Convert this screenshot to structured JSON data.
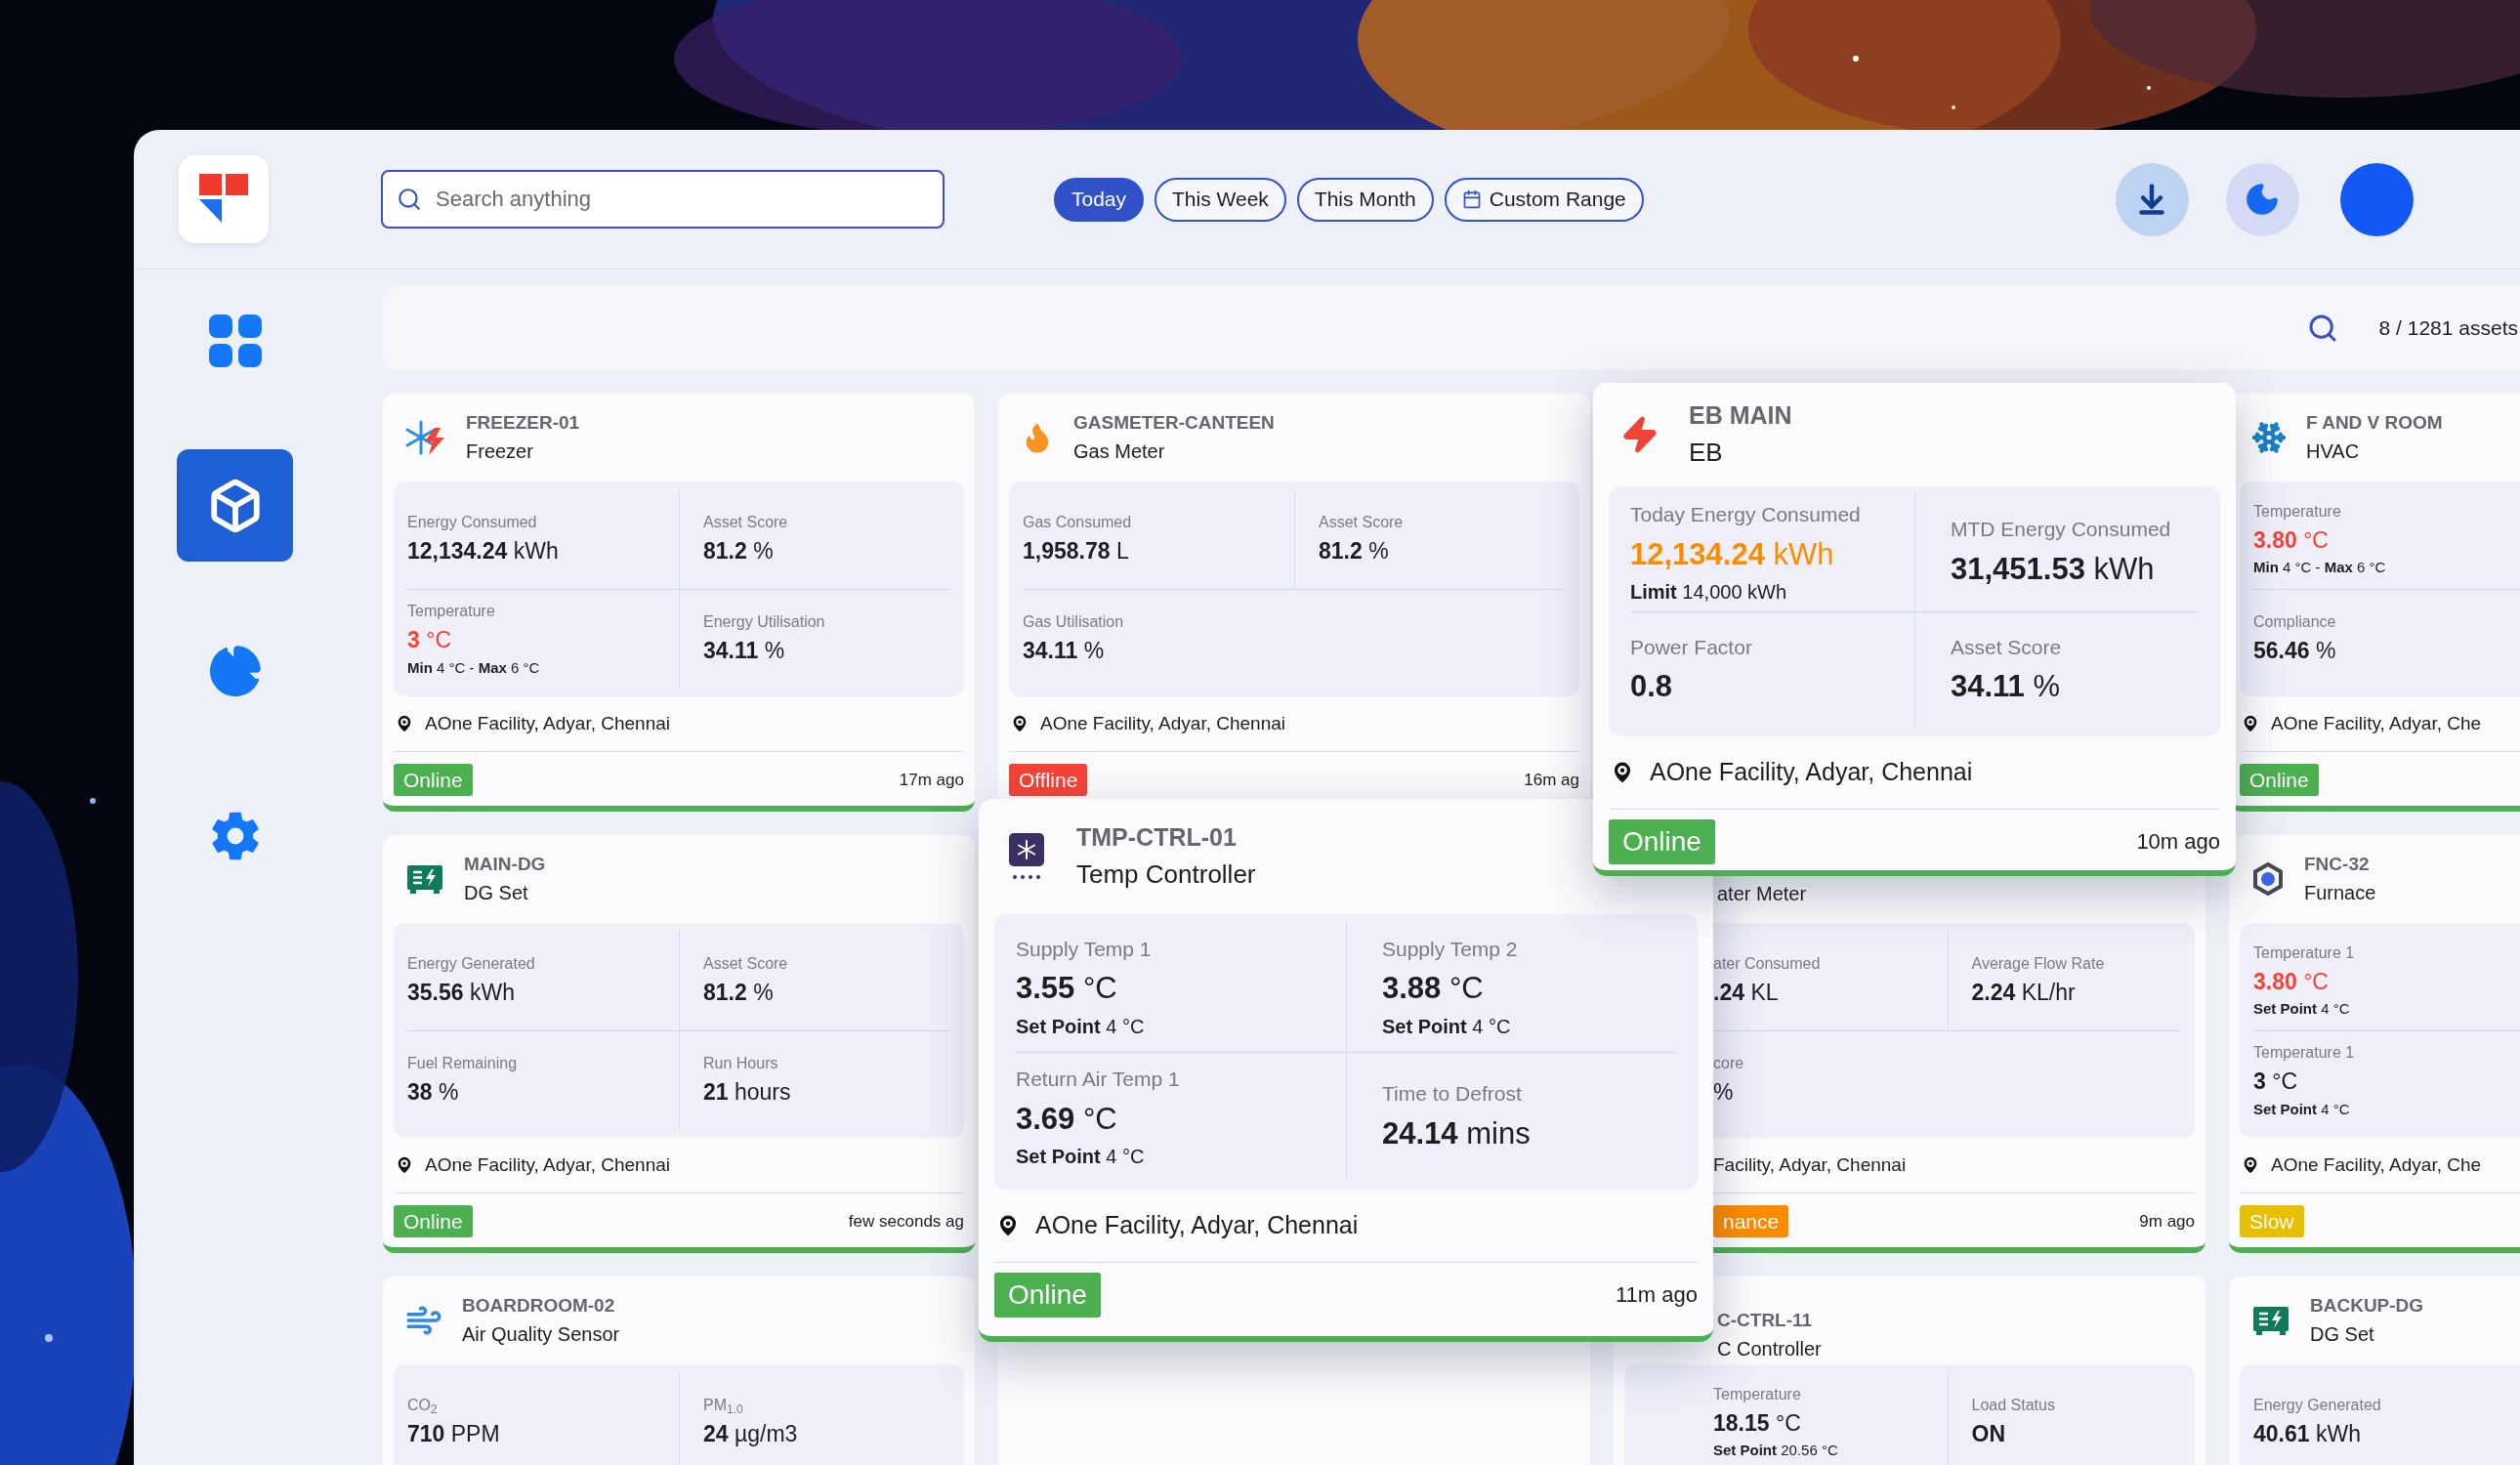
{
  "search": {
    "placeholder": "Search anything"
  },
  "date_filters": [
    {
      "label": "Today",
      "selected": true,
      "kind": "preset"
    },
    {
      "label": "This Week",
      "selected": false,
      "kind": "preset"
    },
    {
      "label": "This Month",
      "selected": false,
      "kind": "preset"
    },
    {
      "label": "Custom Range",
      "selected": false,
      "kind": "range"
    }
  ],
  "sidebar": {
    "items": [
      {
        "kind": "dashboard",
        "selected": false
      },
      {
        "kind": "assets",
        "selected": true
      },
      {
        "kind": "reports",
        "selected": false
      },
      {
        "kind": "settings",
        "selected": false
      }
    ]
  },
  "asset_count": "8 / 1281 assets",
  "cards": [
    {
      "name": "FREEZER-01",
      "type": "Freezer",
      "kind": "freezer",
      "popup": false,
      "rows": [
        [
          {
            "label": "Energy Consumed",
            "value": "12,134.24",
            "unit": "kWh"
          },
          {
            "label": "Asset Score",
            "value": "81.2",
            "unit": "%"
          }
        ],
        [
          {
            "label": "Temperature",
            "value": "3",
            "unit": "°C",
            "color": "#f44336",
            "note": "**Min** 4 °C - **Max** 6 °C"
          },
          {
            "label": "Energy Utilisation",
            "value": "34.11",
            "unit": "%"
          }
        ]
      ],
      "location": "AOne Facility, Adyar, Chennai",
      "status": {
        "label": "Online",
        "kind": "online"
      },
      "time": "17m ago"
    },
    {
      "name": "GASMETER-CANTEEN",
      "type": "Gas Meter",
      "kind": "gas",
      "popup": false,
      "rows": [
        [
          {
            "label": "Gas Consumed",
            "value": "1,958.78",
            "unit": "L"
          },
          {
            "label": "Asset Score",
            "value": "81.2",
            "unit": "%"
          }
        ],
        [
          {
            "label": "Gas Utilisation",
            "value": "34.11",
            "unit": "%"
          }
        ]
      ],
      "location": "AOne Facility, Adyar, Chennai",
      "status": {
        "label": "Offline",
        "kind": "offline"
      },
      "time": "16m ag"
    },
    {
      "name": "EB MAIN",
      "type": "EB",
      "kind": "eb",
      "popup": true,
      "rows": [
        [
          {
            "label": "Today Energy Consumed",
            "value": "12,134.24",
            "unit": "kWh",
            "color": "#fb8c00",
            "note": "**Limit** 14,000 kWh"
          },
          {
            "label": "MTD Energy Consumed",
            "value": "31,451.53",
            "unit": "kWh"
          }
        ],
        [
          {
            "label": "Power Factor",
            "value": "0.8"
          },
          {
            "label": "Asset Score",
            "value": "34.11",
            "unit": "%"
          }
        ]
      ],
      "location": "AOne Facility, Adyar, Chennai",
      "status": {
        "label": "Online",
        "kind": "online"
      },
      "time": "10m ago"
    },
    {
      "name": "F AND V ROOM",
      "type": "HVAC",
      "kind": "hvac",
      "popup": false,
      "rows": [
        [
          {
            "label": "Temperature",
            "value": "3.80",
            "unit": "°C",
            "color": "#f44336",
            "note": "**Min** 4 °C - **Max** 6 °C"
          }
        ],
        [
          {
            "label": "Compliance",
            "value": "56.46",
            "unit": "%"
          }
        ]
      ],
      "location": "AOne Facility, Adyar, Che",
      "status": {
        "label": "Online",
        "kind": "online"
      }
    },
    {
      "name": "MAIN-DG",
      "type": "DG Set",
      "kind": "dg",
      "popup": false,
      "rows": [
        [
          {
            "label": "Energy Generated",
            "value": "35.56",
            "unit": "kWh"
          },
          {
            "label": "Asset Score",
            "value": "81.2",
            "unit": "%"
          }
        ],
        [
          {
            "label": "Fuel Remaining",
            "value": "38",
            "unit": "%"
          },
          {
            "label": "Run Hours",
            "value": "21",
            "unit": "hours"
          }
        ]
      ],
      "location": "AOne Facility, Adyar, Chennai",
      "status": {
        "label": "Online",
        "kind": "online"
      },
      "time": "few seconds ag"
    },
    {
      "name": "TMP-CTRL-01",
      "type": "Temp Controller",
      "kind": "temp",
      "popup": true,
      "rows": [
        [
          {
            "label": "Supply Temp 1",
            "value": "3.55",
            "unit": "°C",
            "note": "**Set Point** 4 °C"
          },
          {
            "label": "Supply Temp 2",
            "value": "3.88",
            "unit": "°C",
            "note": "**Set Point** 4 °C"
          }
        ],
        [
          {
            "label": "Return Air Temp 1",
            "value": "3.69",
            "unit": "°C",
            "note": "**Set Point** 4 °C"
          },
          {
            "label": "Time to Defrost",
            "value": "24.14",
            "unit": "mins"
          }
        ]
      ],
      "location": "AOne Facility, Adyar, Chennai",
      "status": {
        "label": "Online",
        "kind": "online"
      },
      "time": "11m ago"
    },
    {
      "kind": "partial",
      "popup": false,
      "type": "ater Meter",
      "rows": [
        [
          {
            "label": "ater Consumed",
            "value": ".24",
            "unit": "KL"
          },
          {
            "label": "Average Flow Rate",
            "value": "2.24",
            "unit": "KL/hr"
          }
        ],
        [
          {
            "label": "core",
            "unit": "%"
          }
        ]
      ],
      "location": "Facility, Adyar, Chennai",
      "status": {
        "label": "nance",
        "kind": "maintenance"
      },
      "time": "9m ago"
    },
    {
      "name": "FNC-32",
      "type": "Furnace",
      "kind": "furnace",
      "popup": false,
      "rows": [
        [
          {
            "label": "Temperature 1",
            "value": "3.80",
            "unit": "°C",
            "color": "#f44336",
            "note": "**Set Point** 4 °C"
          }
        ],
        [
          {
            "label": "Temperature 1",
            "value": "3",
            "unit": "°C",
            "note": "**Set Point** 4 °C"
          }
        ]
      ],
      "location": "AOne Facility, Adyar, Che",
      "status": {
        "label": "Slow",
        "kind": "slow"
      }
    },
    {
      "name": "BOARDROOM-02",
      "type": "Air Quality Sensor",
      "kind": "air",
      "popup": false,
      "rows": [
        [
          {
            "label": "CO$_{2}$",
            "value": "710",
            "unit": "PPM"
          },
          {
            "label": "PM$_{1.0}$",
            "value": "24",
            "unit": "µg/m3"
          }
        ]
      ]
    },
    {
      "kind": "blank",
      "popup": false
    },
    {
      "kind": "partial",
      "popup": false,
      "name": "C-CTRL-11",
      "type": "C Controller",
      "rows": [
        [
          {
            "label": "Temperature",
            "value": "18.15",
            "unit": "°C",
            "note": "**Set Point** 20.56 °C"
          },
          {
            "label": "Load Status",
            "value": "ON"
          }
        ]
      ]
    },
    {
      "name": "BACKUP-DG",
      "type": "DG Set",
      "kind": "dg",
      "popup": false,
      "rows": [
        [
          {
            "label": "Energy Generated",
            "value": "40.61",
            "unit": "kWh"
          }
        ]
      ]
    }
  ]
}
